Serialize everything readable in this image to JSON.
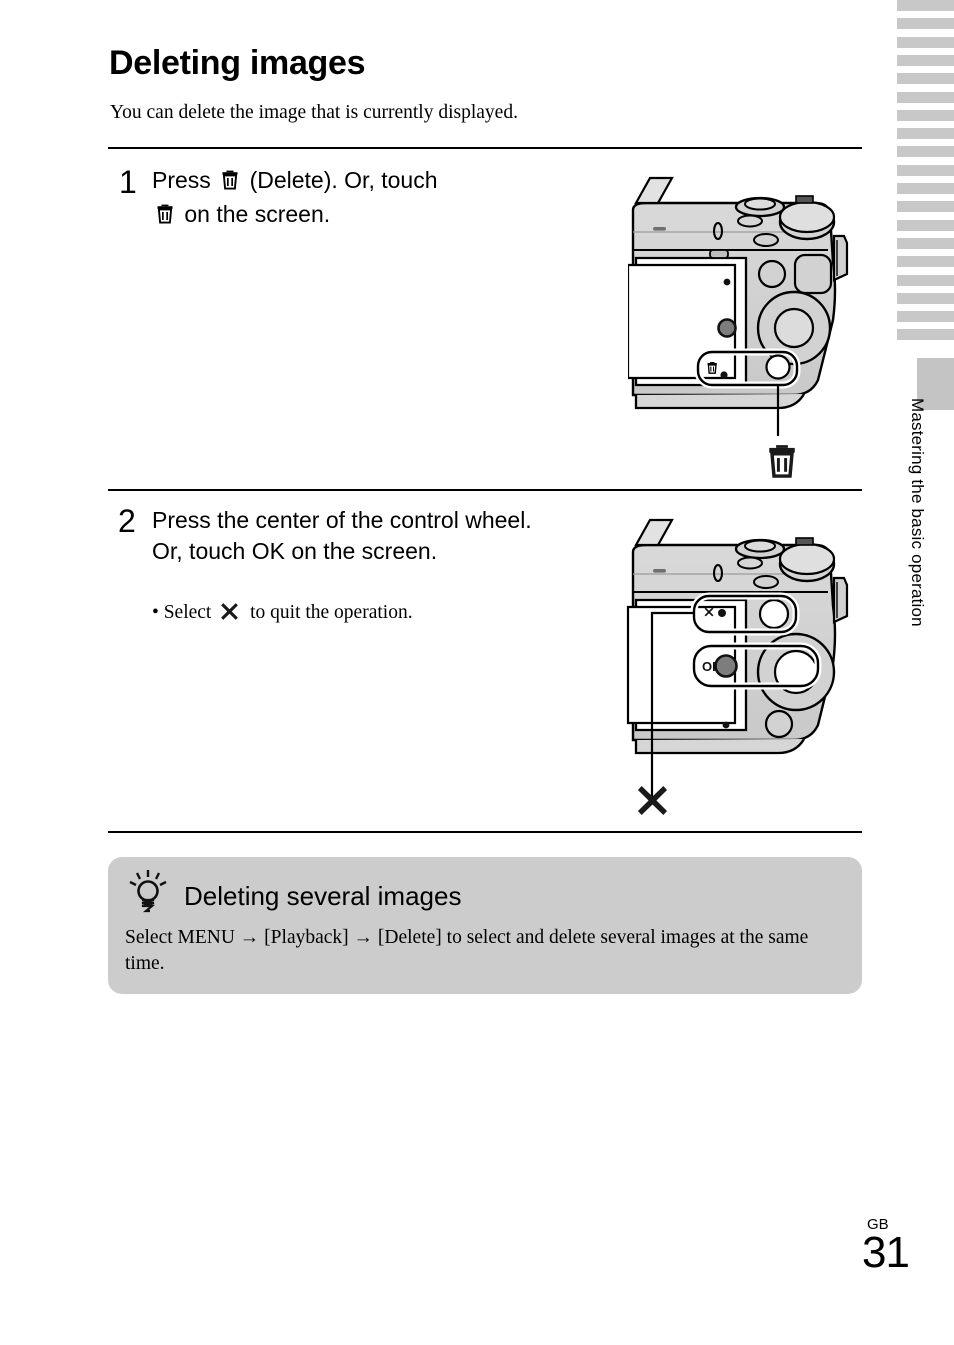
{
  "page": {
    "title": "Deleting images",
    "intro": "You can delete the image that is currently displayed."
  },
  "steps": [
    {
      "number": "1",
      "text_before_icon": "Press",
      "icon": "trash-icon",
      "text_after_icon": "(Delete). Or, touch",
      "text_line2_after_icon": "on the screen.",
      "callout_label": "trash-icon"
    },
    {
      "number": "2",
      "text": "Press the center of the control wheel. Or, touch OK on the screen.",
      "bullet_before_icon": "• Select",
      "bullet_icon": "cross-icon",
      "bullet_after_icon": "to quit the operation.",
      "callout_labels": [
        "cross-icon",
        "OK"
      ]
    }
  ],
  "illustrations": [
    {
      "name": "camera-rear-delete-button",
      "callout_icon": "trash-icon",
      "pointer_icon": "trash-icon"
    },
    {
      "name": "camera-rear-center-button",
      "callout_icons": [
        "cross-icon",
        "ok-label"
      ],
      "pointer_icon": "cross-icon",
      "ok_text": "OK"
    }
  ],
  "tip": {
    "icon": "lightbulb-icon",
    "heading": "Deleting several images",
    "body_parts": [
      "Select MENU",
      "→",
      "[Playback]",
      "→",
      "[Delete] to select and delete several images at the same time."
    ],
    "body_full": "Select MENU → [Playback] → [Delete] to select and delete several images at the same time.",
    "background_color": "#cccccc"
  },
  "sidebar": {
    "chapter_title": "Mastering the basic operation",
    "tab_count": 19,
    "tab_color": "#c8c8c8",
    "active_block_color": "#c4c4c4"
  },
  "footer": {
    "region": "GB",
    "page_number": "31"
  }
}
